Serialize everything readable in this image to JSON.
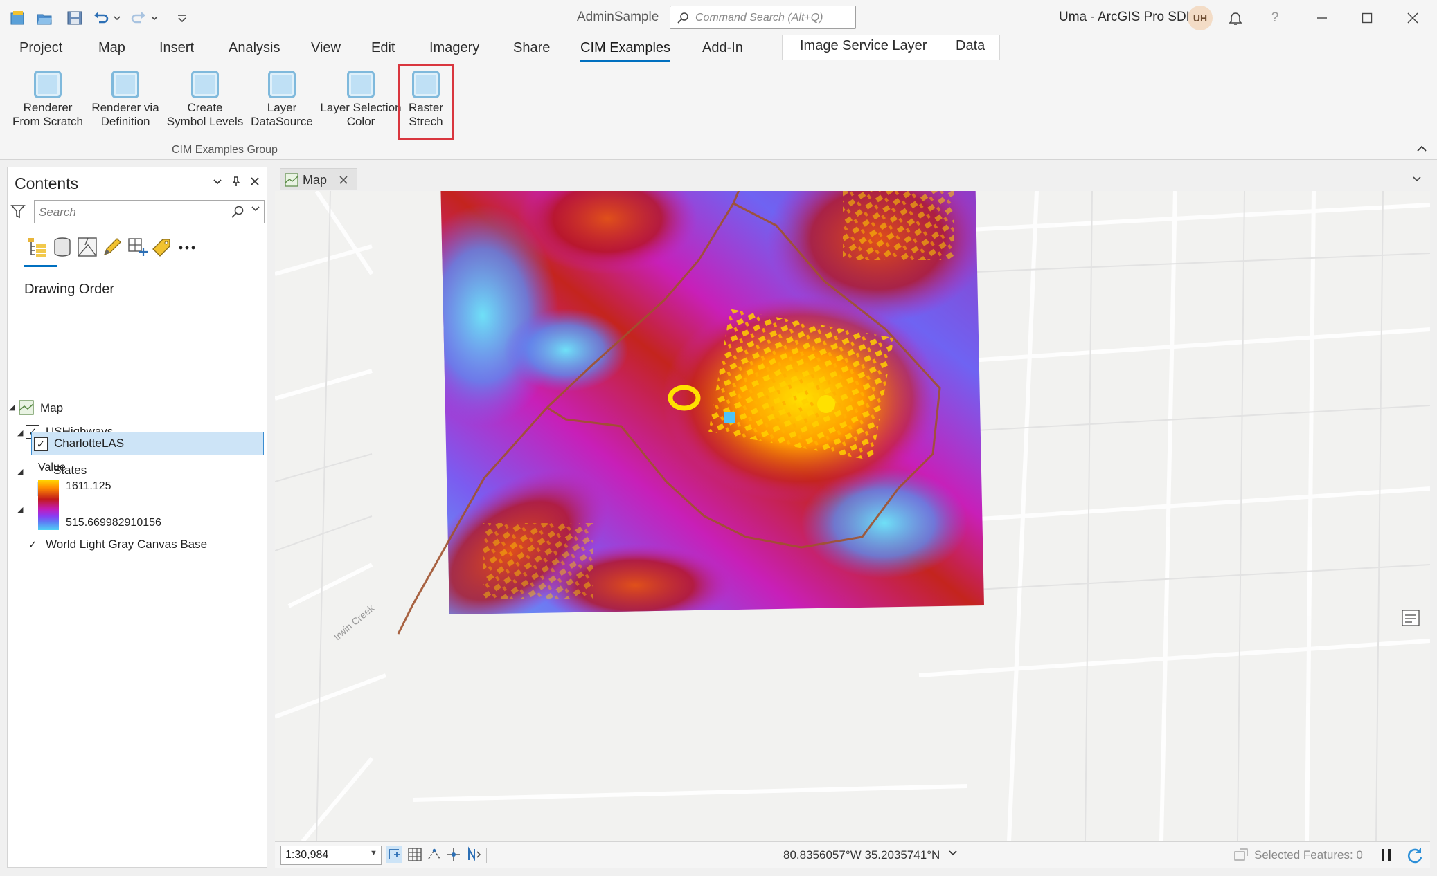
{
  "titlebar": {
    "project_name": "AdminSample",
    "command_search_placeholder": "Command Search (Alt+Q)",
    "app_title": "Uma - ArcGIS Pro SDK",
    "user_initials": "UH",
    "help": "?"
  },
  "ribbon": {
    "tabs": [
      "Project",
      "Map",
      "Insert",
      "Analysis",
      "View",
      "Edit",
      "Imagery",
      "Share",
      "CIM Examples",
      "Add-In"
    ],
    "active_tab": "CIM Examples",
    "context_tabs": [
      "Image Service Layer",
      "Data"
    ],
    "buttons": [
      {
        "line1": "Renderer",
        "line2": "From Scratch"
      },
      {
        "line1": "Renderer via",
        "line2": "Definition"
      },
      {
        "line1": "Create",
        "line2": "Symbol Levels"
      },
      {
        "line1": "Layer",
        "line2": "DataSource"
      },
      {
        "line1": "Layer Selection",
        "line2": "Color"
      },
      {
        "line1": "Raster",
        "line2": "Strech"
      }
    ],
    "group_label": "CIM Examples Group"
  },
  "contents": {
    "title": "Contents",
    "search_placeholder": "Search",
    "drawing_order": "Drawing Order",
    "layers": {
      "map": "Map",
      "highways": "USHighways",
      "states": "States",
      "charlotte": "CharlotteLAS",
      "legend_title": "Value",
      "legend_high": "1611.125",
      "legend_low": "515.669982910156",
      "basemap": "World Light Gray Canvas Base"
    }
  },
  "map_view": {
    "tab_label": "Map",
    "scale": "1:30,984",
    "coordinates": "80.8356057°W 35.2035741°N",
    "selected_features": "Selected Features: 0",
    "basemap_label": "Irwin Creek"
  },
  "colors": {
    "accent": "#0070c0",
    "highlight_box": "#d9363e",
    "highway": "#a0522d",
    "selection": "#cde4f7"
  }
}
